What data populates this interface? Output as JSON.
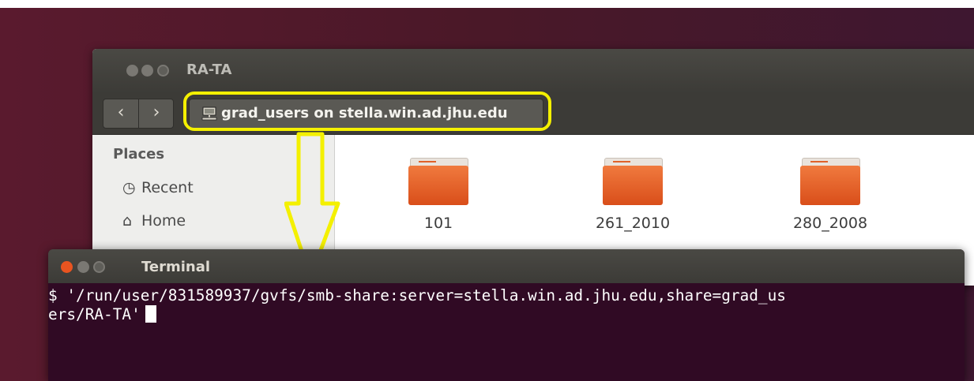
{
  "file_manager": {
    "title": "RA-TA",
    "location": "grad_users on stella.win.ad.jhu.edu",
    "sidebar": {
      "heading": "Places",
      "items": [
        {
          "label": "Recent",
          "icon": "clock-icon"
        },
        {
          "label": "Home",
          "icon": "home-icon"
        }
      ]
    },
    "folders": [
      {
        "label": "101"
      },
      {
        "label": "261_2010"
      },
      {
        "label": "280_2008"
      }
    ]
  },
  "terminal": {
    "title": "Terminal",
    "line1": "$ '/run/user/831589937/gvfs/smb-share:server=stella.win.ad.jhu.edu,share=grad_us",
    "line2": "ers/RA-TA'"
  },
  "colors": {
    "annotation": "#f4f000",
    "terminal_bg": "#300a24",
    "close_button": "#e95420",
    "folder_orange": "#e8632b"
  }
}
